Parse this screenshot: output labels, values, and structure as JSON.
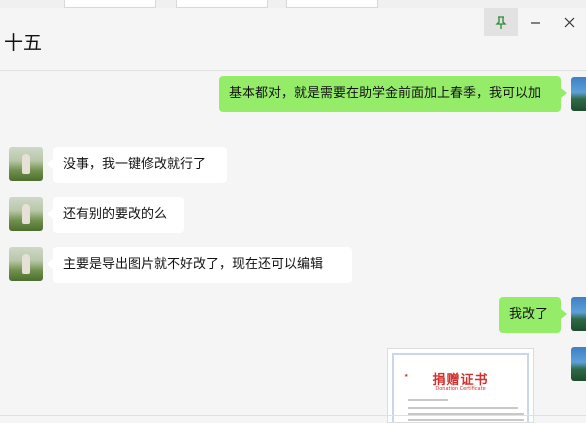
{
  "window": {
    "title": "十五",
    "controls": {
      "pin": "⊤",
      "minimize": "—",
      "close": "✕"
    }
  },
  "messages": [
    {
      "side": "right",
      "text": "基本都对，就是需要在助学金前面加上春季，我可以加"
    },
    {
      "side": "left",
      "text": "没事，我一键修改就行了"
    },
    {
      "side": "left",
      "text": "还有别的要改的么"
    },
    {
      "side": "left",
      "text": "主要是导出图片就不好改了，现在还可以编辑"
    },
    {
      "side": "right",
      "text": "我改了"
    },
    {
      "side": "right",
      "type": "image"
    }
  ],
  "certificate": {
    "title": "捐赠证书",
    "subtitle": "Donation Certificate"
  },
  "colors": {
    "self_bubble": "#95ec69",
    "friend_bubble": "#ffffff",
    "background": "#f5f5f5"
  }
}
